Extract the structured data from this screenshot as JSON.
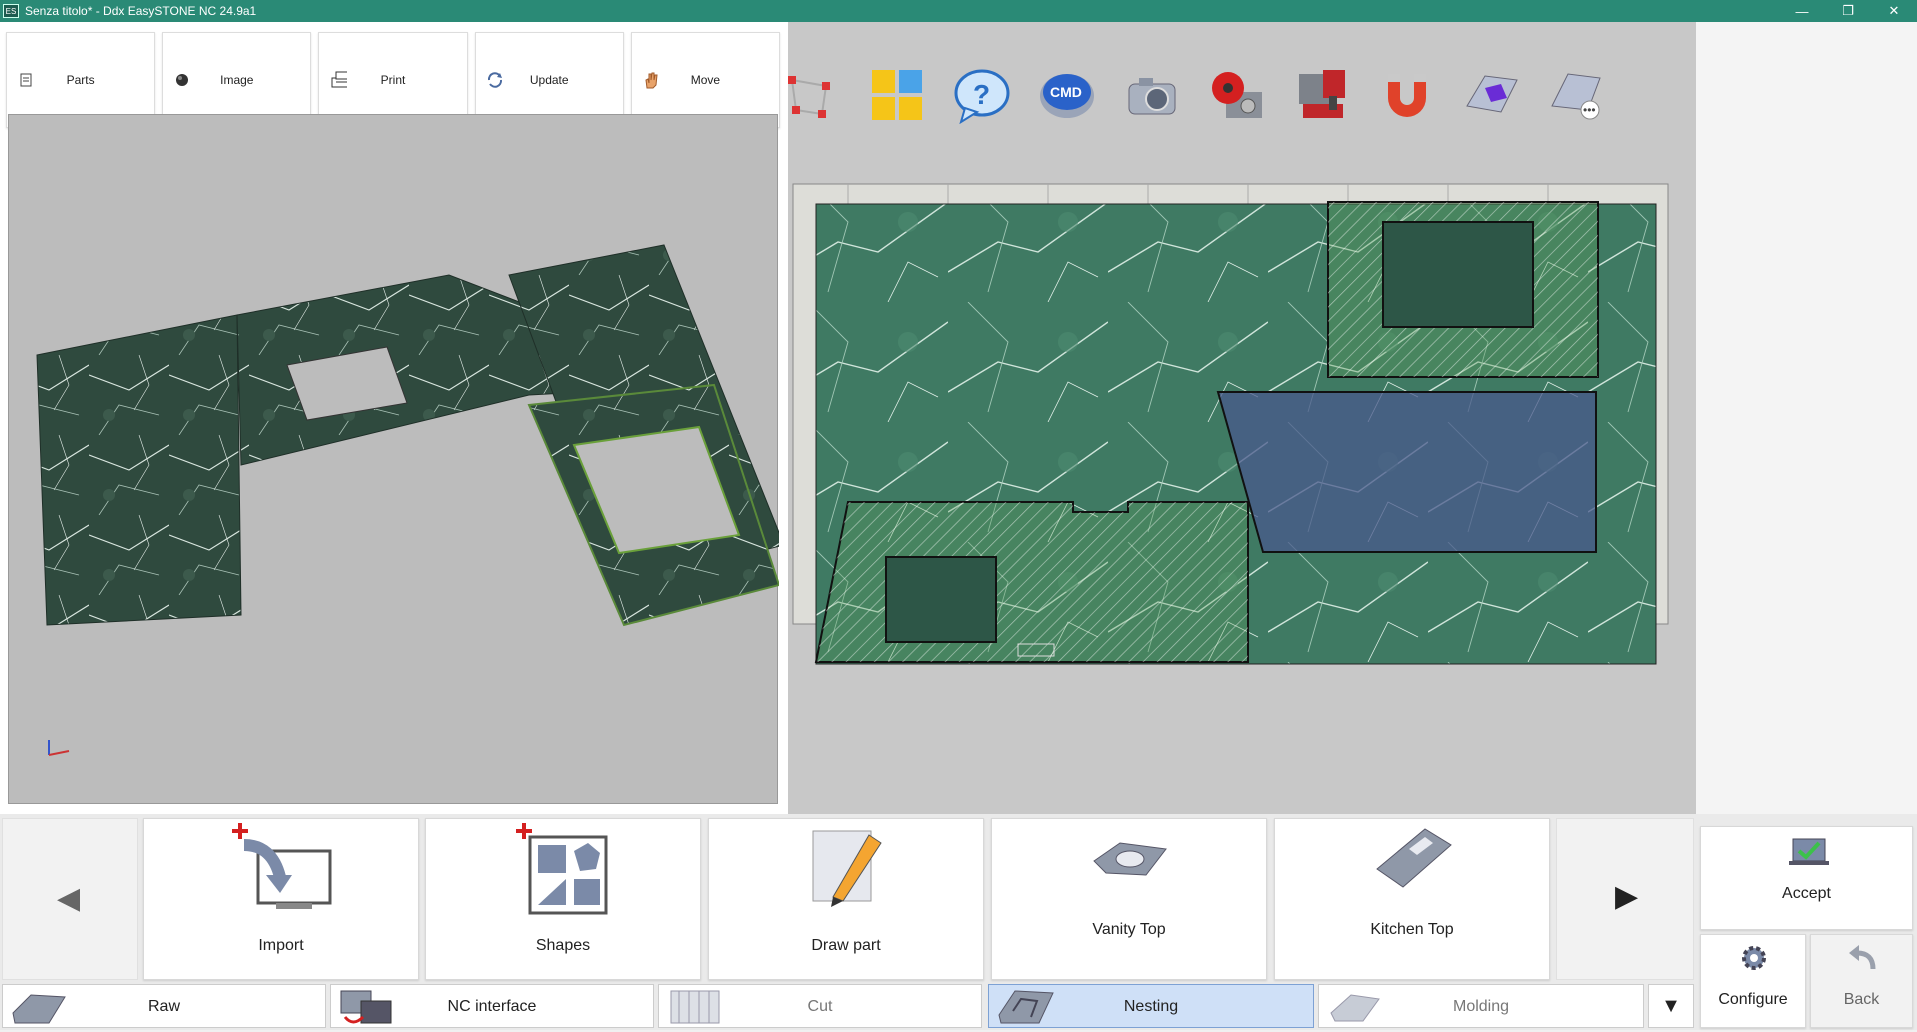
{
  "window": {
    "title": "Senza titolo* - Ddx EasySTONE NC 24.9a1",
    "app_icon": "ES",
    "controls": [
      "—",
      "❐",
      "✕"
    ]
  },
  "toolbar": [
    {
      "label": "Parts",
      "icon": "document-icon"
    },
    {
      "label": "Image",
      "icon": "circle-icon"
    },
    {
      "label": "Print",
      "icon": "printer-icon"
    },
    {
      "label": "Update",
      "icon": "refresh-icon"
    },
    {
      "label": "Move",
      "icon": "hand-icon"
    }
  ],
  "top_icons": [
    {
      "name": "select-points-icon"
    },
    {
      "name": "grid-tiles-icon"
    },
    {
      "name": "help-bubble-icon"
    },
    {
      "name": "cmd-icon",
      "label": "CMD"
    },
    {
      "name": "camera-icon"
    },
    {
      "name": "red-saw-icon"
    },
    {
      "name": "machine-icon"
    },
    {
      "name": "magnet-icon"
    },
    {
      "name": "slab-purple-icon"
    },
    {
      "name": "slab-more-icon"
    }
  ],
  "commands": [
    {
      "label": "Import",
      "icon": "import-icon"
    },
    {
      "label": "Shapes",
      "icon": "shapes-icon"
    },
    {
      "label": "Draw part",
      "icon": "pencil-icon"
    },
    {
      "label": "Vanity Top",
      "icon": "vanity-top-icon"
    },
    {
      "label": "Kitchen Top",
      "icon": "kitchen-top-icon"
    }
  ],
  "nav": {
    "prev": "◀",
    "next": "▶"
  },
  "side_buttons": {
    "accept": "Accept",
    "configure": "Configure",
    "back": "Back"
  },
  "tabs": [
    {
      "label": "Raw",
      "icon": "raw-slab-icon",
      "state": "normal"
    },
    {
      "label": "NC interface",
      "icon": "nc-interface-icon",
      "state": "normal"
    },
    {
      "label": "Cut",
      "icon": "cut-icon",
      "state": "dim"
    },
    {
      "label": "Nesting",
      "icon": "nesting-icon",
      "state": "active"
    },
    {
      "label": "Molding",
      "icon": "molding-icon",
      "state": "dim"
    }
  ],
  "tabs_more": "▼",
  "colors": {
    "titlebar": "#2a8a76",
    "slab_green": "#3d7a62",
    "slab_dark": "#26463a",
    "part_blue": "#4a5a8c",
    "active_tab": "#cfe0f7"
  }
}
